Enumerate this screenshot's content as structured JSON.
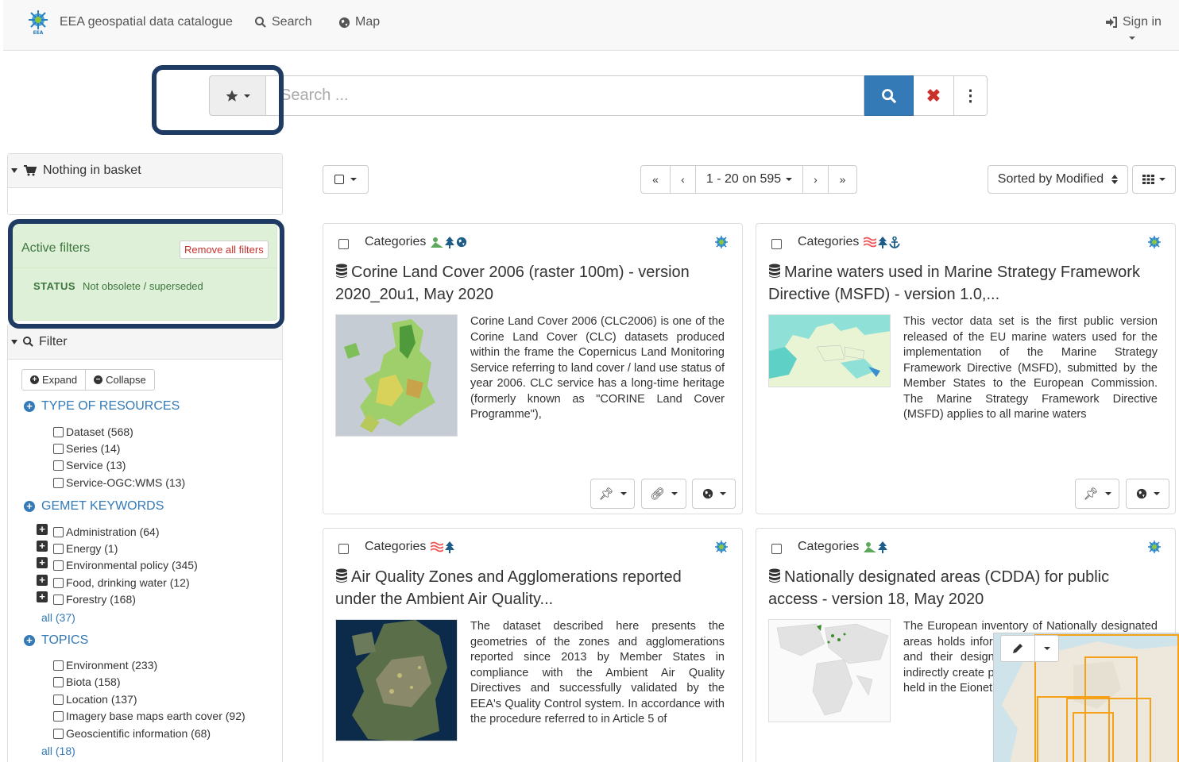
{
  "navbar": {
    "brand": "EEA geospatial data catalogue",
    "search_label": "Search",
    "map_label": "Map",
    "signin_label": "Sign in"
  },
  "searchbar": {
    "placeholder": "Search ..."
  },
  "sidebar": {
    "basket_label": "Nothing in basket",
    "active_filters": {
      "title": "Active filters",
      "remove_label": "Remove all filters",
      "status_key": "STATUS",
      "status_value": "Not obsolete / superseded"
    },
    "filter_label": "Filter",
    "expand_label": "Expand",
    "collapse_label": "Collapse",
    "facets": [
      {
        "title": "TYPE OF RESOURCES",
        "items": [
          "Dataset (568)",
          "Series (14)",
          "Service (13)",
          "Service-OGC:WMS (13)"
        ]
      },
      {
        "title": "GEMET KEYWORDS",
        "items": [
          "Administration (64)",
          "Energy (1)",
          "Environmental policy (345)",
          "Food, drinking water (12)",
          "Forestry (168)"
        ],
        "all": "all (37)"
      },
      {
        "title": "TOPICS",
        "items": [
          "Environment (233)",
          "Biota (158)",
          "Location (137)",
          "Imagery base maps earth cover (92)",
          "Geoscientific information (68)"
        ],
        "all": "all (18)"
      }
    ]
  },
  "toolbar": {
    "pager_range": "1 - 20 on 595",
    "sort_label": "Sorted by Modified"
  },
  "results": [
    {
      "categories_label": "Categories",
      "title": "Corine Land Cover 2006 (raster 100m) - version 2020_20u1, May 2020",
      "abstract": "Corine Land Cover 2006 (CLC2006) is one of the Corine Land Cover (CLC) datasets produced within the frame the Copernicus Land Monitoring Service referring to land cover / land use status of year 2006. CLC service has a long-time heritage (formerly known as \"CORINE Land Cover Programme\"),"
    },
    {
      "categories_label": "Categories",
      "title": "Marine waters used in Marine Strategy Framework Directive (MSFD) - version 1.0,...",
      "abstract": "This vector data set is the first public version released of the EU marine waters used for the implementation of the Marine Strategy Framework Directive (MSFD), submitted by the Member States to the European Commission. The Marine Strategy Framework Directive (MSFD) applies to all marine waters"
    },
    {
      "categories_label": "Categories",
      "title": "Air Quality Zones and Agglomerations reported under the Ambient Air Quality...",
      "abstract": "The dataset described here presents the geometries of the zones and agglomerations reported since 2013 by Member States in compliance with the Ambient Air Quality Directives and successfully validated by the EEA's Quality Control system. In accordance with the procedure referred to in Article 5 of"
    },
    {
      "categories_label": "Categories",
      "title": "Nationally designated areas (CDDA) for public access - version 18, May 2020",
      "abstract": "The European inventory of Nationally designated areas holds information about designated areas and their designation types, which directly or indirectly create protected areas. The database is held in the Eionet partner... tabular information..."
    }
  ],
  "colors": {
    "primary": "#337ab7",
    "highlight_border": "#1f3b63",
    "filter_green_bg": "#dff0d8",
    "filter_green_text": "#3c763d",
    "danger": "#c9302c"
  },
  "icons": [
    "eea-logo",
    "search-icon",
    "globe-icon",
    "sign-in-icon",
    "star-icon",
    "times-icon",
    "ellipsis-v-icon",
    "shopping-cart-icon",
    "filter-search-icon",
    "plus-circle-icon",
    "minus-circle-icon",
    "checkbox-icon",
    "database-icon",
    "thumbtack-icon",
    "link-icon",
    "globe-dropdown-icon",
    "pencil-icon",
    "grid-view-icon",
    "sort-icon"
  ]
}
